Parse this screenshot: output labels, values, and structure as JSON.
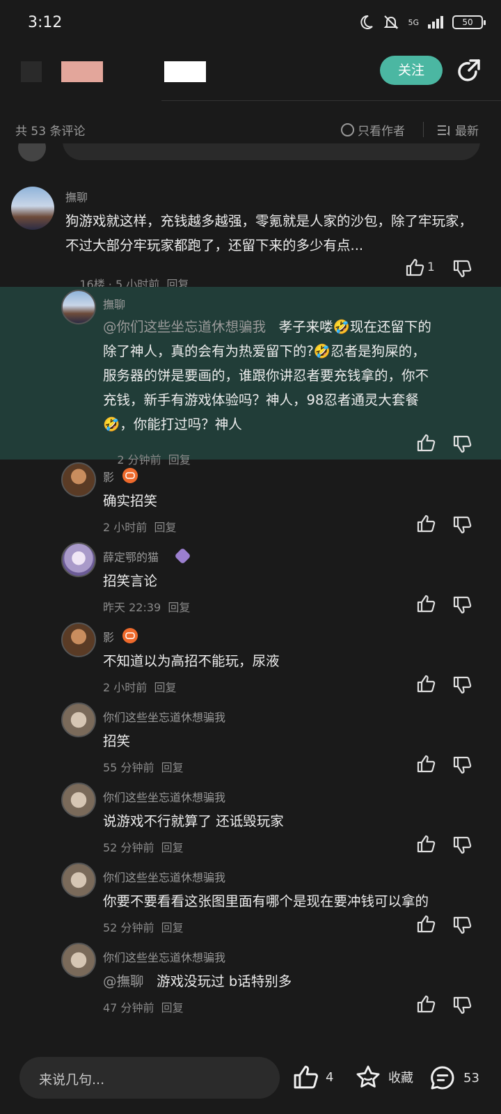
{
  "status_bar": {
    "time": "3:12",
    "network": "5G",
    "battery": "50"
  },
  "header": {
    "follow_label": "关注"
  },
  "sort_bar": {
    "count_text": "共 53 条评论",
    "author_only": "只看作者",
    "latest": "最新"
  },
  "comments": [
    {
      "user": "撫聊",
      "text": "狗游戏就这样，充钱越多越强，零氪就是人家的沙包，除了牢玩家，不过大部分牢玩家都跑了，还留下来的多少有点...",
      "floor": "16楼",
      "time": "5 小时前",
      "reply": "回复",
      "likes": "1"
    },
    {
      "user": "撫聊",
      "mention": "@你们这些坐忘道休想骗我",
      "text_lines": [
        "孝子来喽🤣现在还留下的",
        "除了神人，真的会有为热爱留下的?🤣忍者是狗屎的，",
        "服务器的饼是要画的，谁跟你讲忍者要充钱拿的，你不",
        "充钱，新手有游戏体验吗？神人，98忍者通灵大套餐",
        "🤣，你能打过吗？神人"
      ],
      "time": "2 分钟前",
      "reply": "回复"
    },
    {
      "user": "影",
      "text": "确实招笑",
      "time": "2 小时前",
      "reply": "回复"
    },
    {
      "user": "薛定鄂的猫",
      "text": "招笑言论",
      "time": "昨天 22:39",
      "reply": "回复"
    },
    {
      "user": "影",
      "text": "不知道以为高招不能玩，尿液",
      "time": "2 小时前",
      "reply": "回复"
    },
    {
      "user": "你们这些坐忘道休想骗我",
      "text": "招笑",
      "time": "55 分钟前",
      "reply": "回复"
    },
    {
      "user": "你们这些坐忘道休想骗我",
      "text": "说游戏不行就算了 还诋毁玩家",
      "time": "52 分钟前",
      "reply": "回复"
    },
    {
      "user": "你们这些坐忘道休想骗我",
      "text": "你要不要看看这张图里面有哪个是现在要冲钱可以拿的",
      "time": "52 分钟前",
      "reply": "回复"
    },
    {
      "user": "你们这些坐忘道休想骗我",
      "mention": "@撫聊",
      "text": "游戏没玩过 b话特别多",
      "time": "47 分钟前",
      "reply": "回复"
    }
  ],
  "bottom_bar": {
    "placeholder": "来说几句...",
    "likes": "4",
    "favorite_label": "收藏",
    "comments": "53"
  },
  "colors": {
    "accent": "#4bb7a2",
    "highlight": "#213d38",
    "background": "#1a1a1a"
  }
}
